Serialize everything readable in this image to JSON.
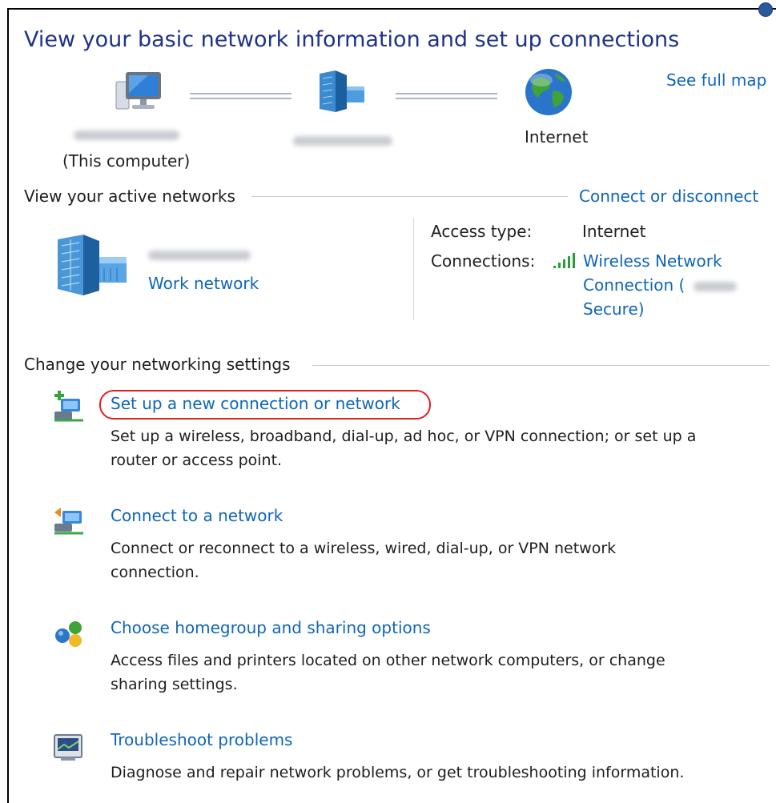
{
  "header": {
    "title": "View your basic network information and set up connections",
    "see_full_map": "See full map"
  },
  "map": {
    "computer_sub": "(This computer)",
    "internet_label": "Internet"
  },
  "active_networks": {
    "section_label": "View your active networks",
    "connect_link": "Connect or disconnect",
    "network_type_link": "Work network",
    "access_type_label": "Access type:",
    "access_type_value": "Internet",
    "connections_label": "Connections:",
    "connection_line1": "Wireless Network",
    "connection_line2": "Connection (",
    "connection_line3": "Secure)"
  },
  "settings": {
    "section_label": "Change your networking settings",
    "tasks": [
      {
        "icon": "new-connection-icon",
        "link": "Set up a new connection or network",
        "desc1": "Set up a wireless, broadband, dial-up, ad hoc, or VPN connection; or set up a",
        "desc2": "router or access point."
      },
      {
        "icon": "connect-network-icon",
        "link": "Connect to a network",
        "desc1": "Connect or reconnect to a wireless, wired, dial-up, or VPN network",
        "desc2": "connection."
      },
      {
        "icon": "homegroup-icon",
        "link": "Choose homegroup and sharing options",
        "desc1": "Access files and printers located on other network computers, or change",
        "desc2": "sharing settings."
      },
      {
        "icon": "troubleshoot-icon",
        "link": "Troubleshoot problems",
        "desc1": "Diagnose and repair network problems, or get troubleshooting information."
      }
    ]
  },
  "colors": {
    "title": "#1e3287",
    "link": "#0f66b8",
    "highlight": "#e0221f"
  }
}
